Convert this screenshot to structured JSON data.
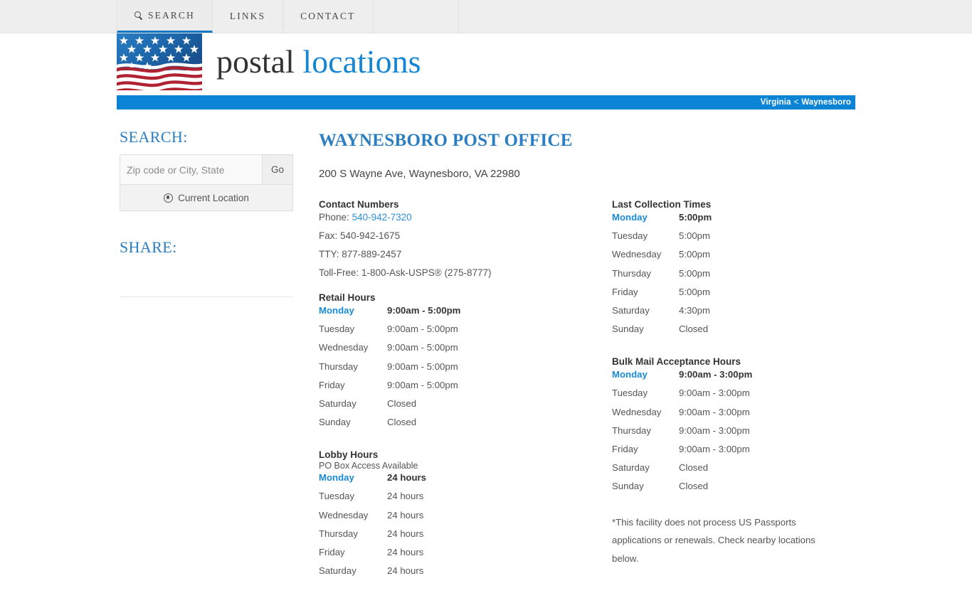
{
  "nav": {
    "items": [
      {
        "label": "SEARCH",
        "icon": "search-icon",
        "active": true
      },
      {
        "label": "LINKS",
        "icon": null,
        "active": false
      },
      {
        "label": "CONTACT",
        "icon": null,
        "active": false
      }
    ]
  },
  "brand": {
    "word1": "postal",
    "word2": "locations",
    "logo_icon": "us-flag-icon"
  },
  "breadcrumb": {
    "state": "Virginia",
    "separator": "<",
    "city": "Waynesboro"
  },
  "sidebar": {
    "search_heading": "SEARCH:",
    "search_placeholder": "Zip code or City, State",
    "search_value": "",
    "go_label": "Go",
    "current_location_label": "Current Location",
    "current_location_icon": "crosshair-location-icon",
    "share_heading": "SHARE:"
  },
  "main": {
    "title": "WAYNESBORO POST OFFICE",
    "address": "200 S Wayne Ave, Waynesboro, VA 22980",
    "contact": {
      "heading": "Contact Numbers",
      "phone_label": "Phone:",
      "phone_value": "540-942-7320",
      "fax": "Fax: 540-942-1675",
      "tty": "TTY: 877-889-2457",
      "tollfree": "Toll-Free: 1-800-Ask-USPS® (275-8777)"
    },
    "retail_hours": {
      "heading": "Retail Hours",
      "rows": [
        {
          "day": "Monday",
          "value": "9:00am - 5:00pm",
          "today": true
        },
        {
          "day": "Tuesday",
          "value": "9:00am - 5:00pm",
          "today": false
        },
        {
          "day": "Wednesday",
          "value": "9:00am - 5:00pm",
          "today": false
        },
        {
          "day": "Thursday",
          "value": "9:00am - 5:00pm",
          "today": false
        },
        {
          "day": "Friday",
          "value": "9:00am - 5:00pm",
          "today": false
        },
        {
          "day": "Saturday",
          "value": "Closed",
          "today": false
        },
        {
          "day": "Sunday",
          "value": "Closed",
          "today": false
        }
      ]
    },
    "lobby_hours": {
      "heading": "Lobby Hours",
      "subheading": "PO Box Access Available",
      "rows": [
        {
          "day": "Monday",
          "value": "24 hours",
          "today": true
        },
        {
          "day": "Tuesday",
          "value": "24 hours",
          "today": false
        },
        {
          "day": "Wednesday",
          "value": "24 hours",
          "today": false
        },
        {
          "day": "Thursday",
          "value": "24 hours",
          "today": false
        },
        {
          "day": "Friday",
          "value": "24 hours",
          "today": false
        },
        {
          "day": "Saturday",
          "value": "24 hours",
          "today": false
        }
      ]
    },
    "last_collection": {
      "heading": "Last Collection Times",
      "rows": [
        {
          "day": "Monday",
          "value": "5:00pm",
          "today": true
        },
        {
          "day": "Tuesday",
          "value": "5:00pm",
          "today": false
        },
        {
          "day": "Wednesday",
          "value": "5:00pm",
          "today": false
        },
        {
          "day": "Thursday",
          "value": "5:00pm",
          "today": false
        },
        {
          "day": "Friday",
          "value": "5:00pm",
          "today": false
        },
        {
          "day": "Saturday",
          "value": "4:30pm",
          "today": false
        },
        {
          "day": "Sunday",
          "value": "Closed",
          "today": false
        }
      ]
    },
    "bulk_mail": {
      "heading": "Bulk Mail Acceptance Hours",
      "rows": [
        {
          "day": "Monday",
          "value": "9:00am - 3:00pm",
          "today": true
        },
        {
          "day": "Tuesday",
          "value": "9:00am - 3:00pm",
          "today": false
        },
        {
          "day": "Wednesday",
          "value": "9:00am - 3:00pm",
          "today": false
        },
        {
          "day": "Thursday",
          "value": "9:00am - 3:00pm",
          "today": false
        },
        {
          "day": "Friday",
          "value": "9:00am - 3:00pm",
          "today": false
        },
        {
          "day": "Saturday",
          "value": "Closed",
          "today": false
        },
        {
          "day": "Sunday",
          "value": "Closed",
          "today": false
        }
      ]
    },
    "passport_note": "*This facility does not process US Passports applications or renewals. Check nearby locations below."
  },
  "colors": {
    "accent_blue": "#2b7ec1",
    "link_blue": "#2b8fd6",
    "breadcrumb_blue": "#0b84d6",
    "nav_bg": "#eeeeee",
    "today_blue": "#1a8ad4",
    "text_gray": "#555555",
    "flag_blue": "#1b5b9e",
    "flag_red": "#b12231"
  }
}
